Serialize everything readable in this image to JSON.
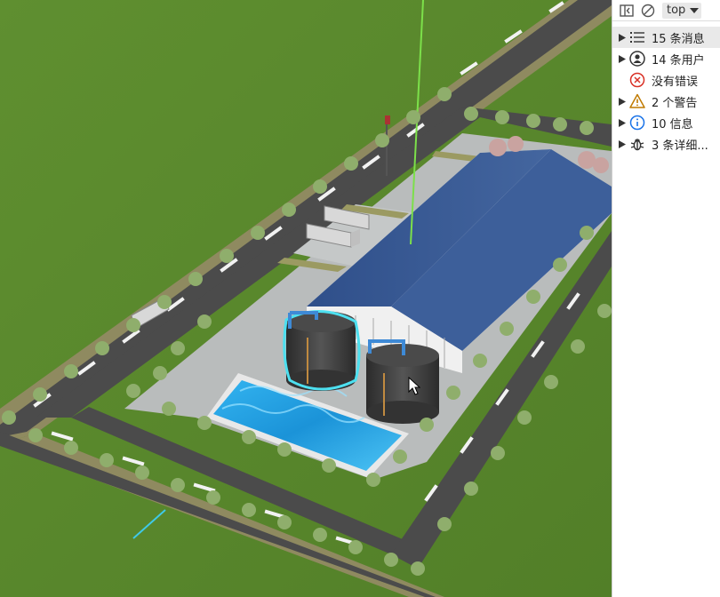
{
  "devtools": {
    "context_selector": {
      "value": "top"
    },
    "messages": [
      {
        "label": "15 条消息",
        "icon": "list-icon",
        "expandable": true,
        "selected": true
      },
      {
        "label": "14 条用户",
        "icon": "user-icon",
        "expandable": true,
        "selected": false
      },
      {
        "label": "没有错误",
        "icon": "error-icon",
        "expandable": false,
        "selected": false
      },
      {
        "label": "2 个警告",
        "icon": "warning-icon",
        "expandable": true,
        "selected": false
      },
      {
        "label": "10 信息",
        "icon": "info-icon",
        "expandable": true,
        "selected": false
      },
      {
        "label": "3 条详细...",
        "icon": "bug-icon",
        "expandable": true,
        "selected": false
      }
    ],
    "colors": {
      "error": "#d93025",
      "warning": "#c07a00",
      "info": "#1a73e8",
      "selected_bg": "#e9e9e9"
    }
  },
  "scene": {
    "colors": {
      "grass": "#5b8a2e",
      "road": "#4b4b4b",
      "pavement": "#b9bcbc",
      "roof": "#3a5a94",
      "water": "#1f9de0",
      "highlight": "#4de0f0"
    }
  }
}
